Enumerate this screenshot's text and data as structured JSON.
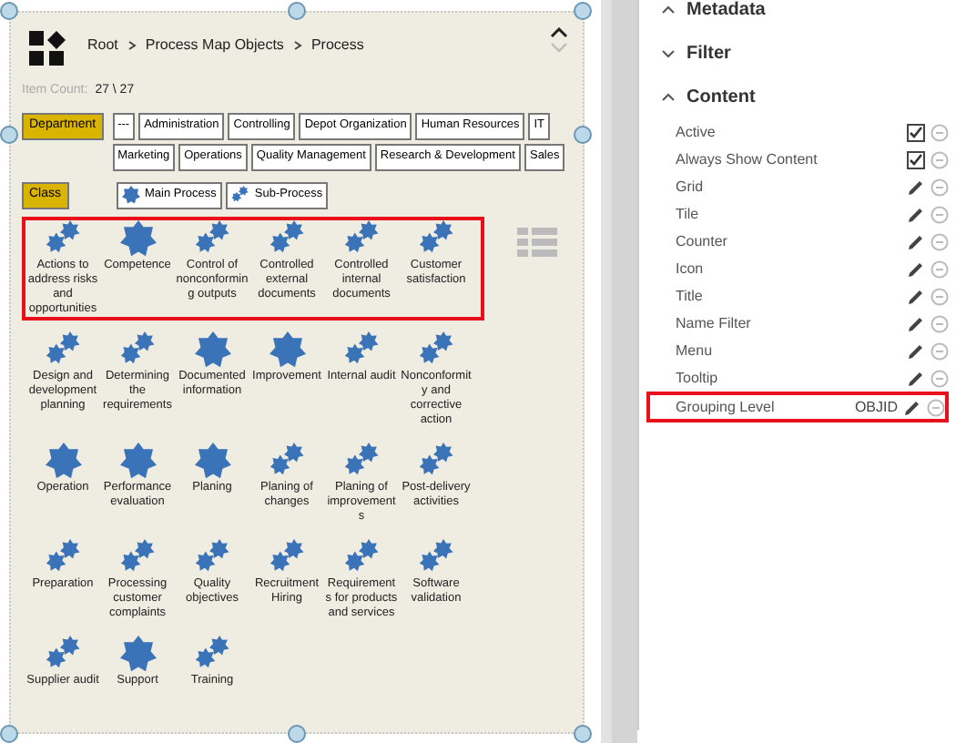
{
  "breadcrumb": [
    {
      "label": "Root"
    },
    {
      "label": "Process Map Objects"
    },
    {
      "label": "Process"
    }
  ],
  "item_count": {
    "label": "Item Count:",
    "value": "27 \\ 27"
  },
  "filters": [
    {
      "label": "Department",
      "options": [
        {
          "label": "---"
        },
        {
          "label": "Administration"
        },
        {
          "label": "Controlling"
        },
        {
          "label": "Depot Organization"
        },
        {
          "label": "Human Resources"
        },
        {
          "label": "IT"
        },
        {
          "label": "Marketing"
        },
        {
          "label": "Operations"
        },
        {
          "label": "Quality Management"
        },
        {
          "label": "Research & Development"
        },
        {
          "label": "Sales"
        }
      ]
    },
    {
      "label": "Class",
      "options": [
        {
          "label": "Main Process",
          "kind": "main"
        },
        {
          "label": "Sub-Process",
          "kind": "sub"
        }
      ]
    }
  ],
  "rows": [
    {
      "highlighted": true,
      "items": [
        {
          "label": "Actions to address risks and opportunities",
          "kind": "sub"
        },
        {
          "label": "Competence",
          "kind": "main"
        },
        {
          "label": "Control of nonconforming outputs",
          "kind": "sub"
        },
        {
          "label": "Controlled external documents",
          "kind": "sub"
        },
        {
          "label": "Controlled internal documents",
          "kind": "sub"
        },
        {
          "label": "Customer satisfaction",
          "kind": "sub"
        }
      ]
    },
    {
      "highlighted": false,
      "items": [
        {
          "label": "Design and development planning",
          "kind": "sub"
        },
        {
          "label": "Determining the requirements",
          "kind": "sub"
        },
        {
          "label": "Documented information",
          "kind": "main"
        },
        {
          "label": "Improvement",
          "kind": "main"
        },
        {
          "label": "Internal audit",
          "kind": "sub"
        },
        {
          "label": "Nonconformity and corrective action",
          "kind": "sub"
        }
      ]
    },
    {
      "highlighted": false,
      "items": [
        {
          "label": "Operation",
          "kind": "main"
        },
        {
          "label": "Performance evaluation",
          "kind": "main"
        },
        {
          "label": "Planing",
          "kind": "main"
        },
        {
          "label": "Planing of changes",
          "kind": "sub"
        },
        {
          "label": "Planing of improvements",
          "kind": "sub"
        },
        {
          "label": "Post-delivery activities",
          "kind": "sub"
        }
      ]
    },
    {
      "highlighted": false,
      "items": [
        {
          "label": "Preparation",
          "kind": "sub"
        },
        {
          "label": "Processing customer complaints",
          "kind": "sub"
        },
        {
          "label": "Quality objectives",
          "kind": "sub"
        },
        {
          "label": "Recruitment Hiring",
          "kind": "sub"
        },
        {
          "label": "Requirements for products and services",
          "kind": "sub"
        },
        {
          "label": "Software validation",
          "kind": "sub"
        }
      ]
    },
    {
      "highlighted": false,
      "items": [
        {
          "label": "Supplier audit",
          "kind": "sub"
        },
        {
          "label": "Support",
          "kind": "main"
        },
        {
          "label": "Training",
          "kind": "sub"
        }
      ]
    }
  ],
  "sections": [
    {
      "title": "Metadata",
      "expanded": true
    },
    {
      "title": "Filter",
      "expanded": false
    },
    {
      "title": "Content",
      "expanded": true,
      "properties": [
        {
          "name": "Active",
          "kind": "checkbox",
          "checked": true,
          "highlighted": false
        },
        {
          "name": "Always Show Content",
          "kind": "checkbox",
          "checked": true,
          "highlighted": false
        },
        {
          "name": "Grid",
          "kind": "edit",
          "highlighted": false
        },
        {
          "name": "Tile",
          "kind": "edit",
          "highlighted": false
        },
        {
          "name": "Counter",
          "kind": "edit",
          "highlighted": false
        },
        {
          "name": "Icon",
          "kind": "edit",
          "highlighted": false
        },
        {
          "name": "Title",
          "kind": "edit",
          "highlighted": false
        },
        {
          "name": "Name Filter",
          "kind": "edit",
          "highlighted": false
        },
        {
          "name": "Menu",
          "kind": "edit",
          "highlighted": false
        },
        {
          "name": "Tooltip",
          "kind": "edit",
          "highlighted": false
        },
        {
          "name": "Grouping Level",
          "kind": "edit",
          "value": "OBJID",
          "highlighted": true
        }
      ]
    }
  ]
}
